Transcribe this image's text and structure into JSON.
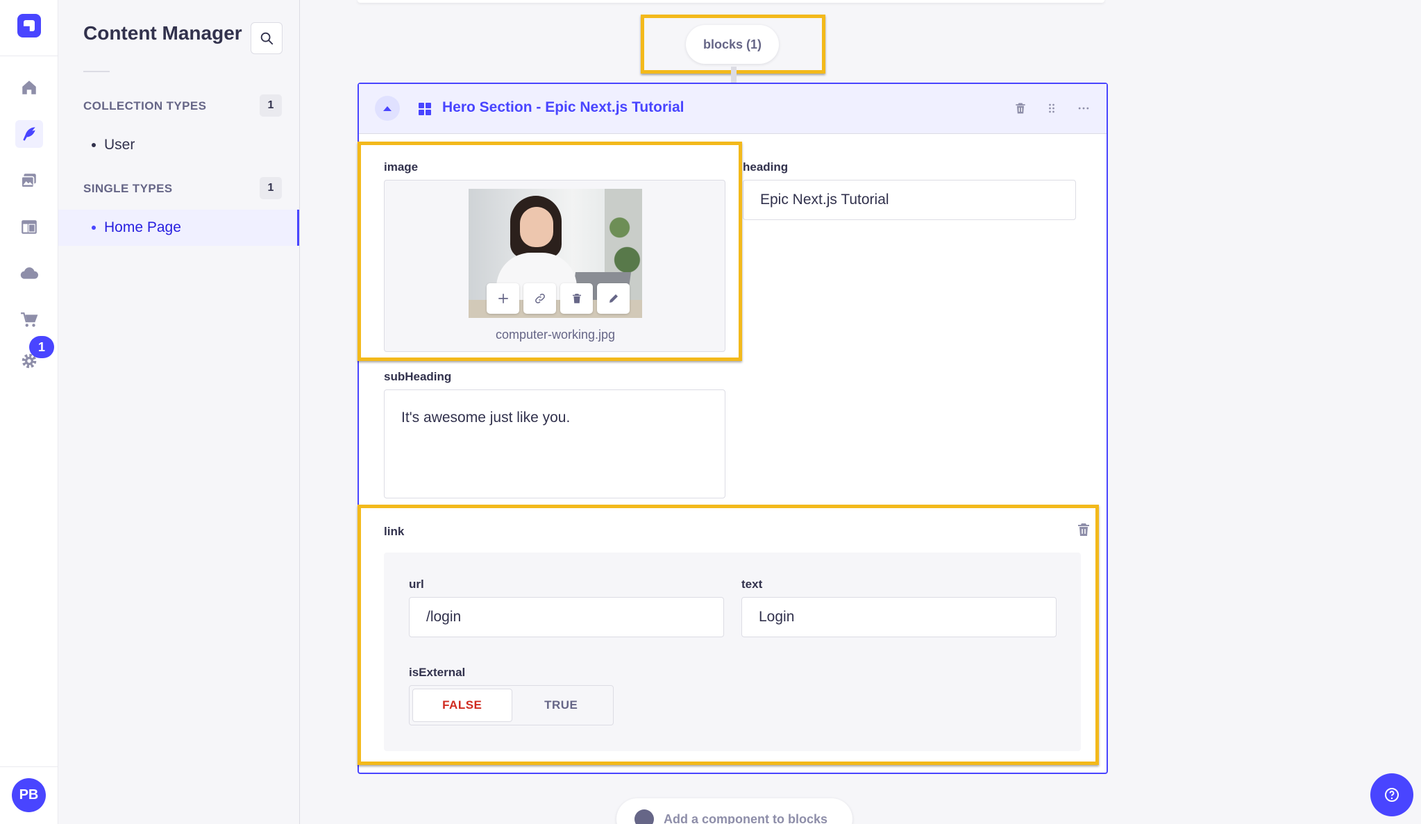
{
  "nav": {
    "icons": [
      "home-icon",
      "content-manager-icon",
      "media-library-icon",
      "content-type-builder-icon",
      "cloud-icon",
      "marketplace-icon",
      "settings-icon"
    ],
    "settings_badge": "1",
    "avatar_initials": "PB"
  },
  "subnav": {
    "title": "Content Manager",
    "collection_types": {
      "label": "COLLECTION TYPES",
      "count": "1",
      "items": [
        "User"
      ]
    },
    "single_types": {
      "label": "SINGLE TYPES",
      "count": "1",
      "items": [
        "Home Page"
      ]
    }
  },
  "editor": {
    "blocks_pill": "blocks (1)",
    "block_title": "Hero Section - Epic Next.js Tutorial",
    "image_label": "image",
    "image_filename": "computer-working.jpg",
    "heading_label": "heading",
    "heading_value": "Epic Next.js Tutorial",
    "subheading_label": "subHeading",
    "subheading_value": "It's awesome just like you.",
    "link": {
      "label": "link",
      "url_label": "url",
      "url_value": "/login",
      "text_label": "text",
      "text_value": "Login",
      "is_external_label": "isExternal",
      "false_label": "FALSE",
      "true_label": "TRUE",
      "selected": "FALSE"
    },
    "add_component_label": "Add a component to blocks"
  },
  "colors": {
    "primary": "#4945ff",
    "highlight": "#f3b91b",
    "danger": "#d02b20"
  }
}
